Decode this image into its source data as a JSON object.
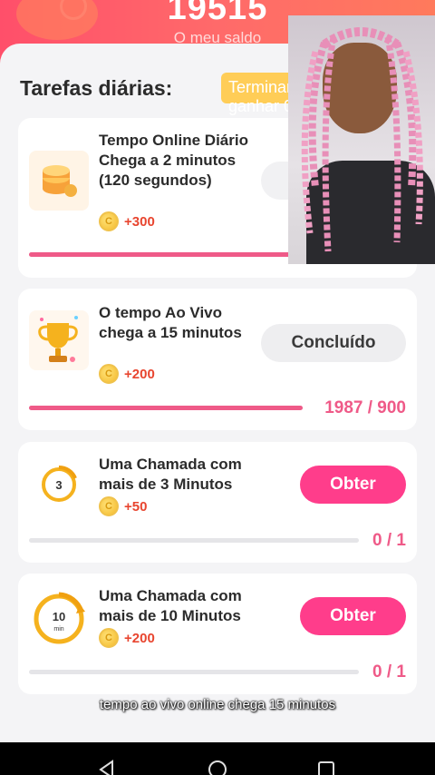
{
  "balance": {
    "value": "19515",
    "label": "O meu saldo"
  },
  "daily": {
    "title": "Tarefas diárias:",
    "finish_label": "Terminar tarefas e ganhar 0"
  },
  "tasks": [
    {
      "title": "Tempo Online Diário Chega a 2 minutos (120 segundos)",
      "reward": "+300",
      "icon": "coin-stack-icon",
      "progress_fraction": 1.0,
      "progress_text": "",
      "action": ""
    },
    {
      "title": "O tempo  Ao Vivo chega a 15 minutos",
      "reward": "+200",
      "icon": "trophy-icon",
      "progress_fraction": 1.0,
      "progress_text": "1987 / 900",
      "action": "Concluído"
    },
    {
      "title": "Uma Chamada com mais de 3 Minutos",
      "reward": "+50",
      "icon": "3-min-timer-icon",
      "progress_fraction": 0.0,
      "progress_text": "0 / 1",
      "action": "Obter"
    },
    {
      "title": "Uma Chamada com mais de 10 Minutos",
      "reward": "+200",
      "icon": "10-min-timer-icon",
      "progress_fraction": 0.0,
      "progress_text": "0 / 1",
      "action": "Obter"
    }
  ],
  "caption": "tempo ao vivo online chega 15 minutos",
  "colors": {
    "accent": "#ff3d8b",
    "progress": "#ef5a88",
    "reward": "#e8452f",
    "banner": "#ff5a6a",
    "finish": "#ffcd57"
  }
}
